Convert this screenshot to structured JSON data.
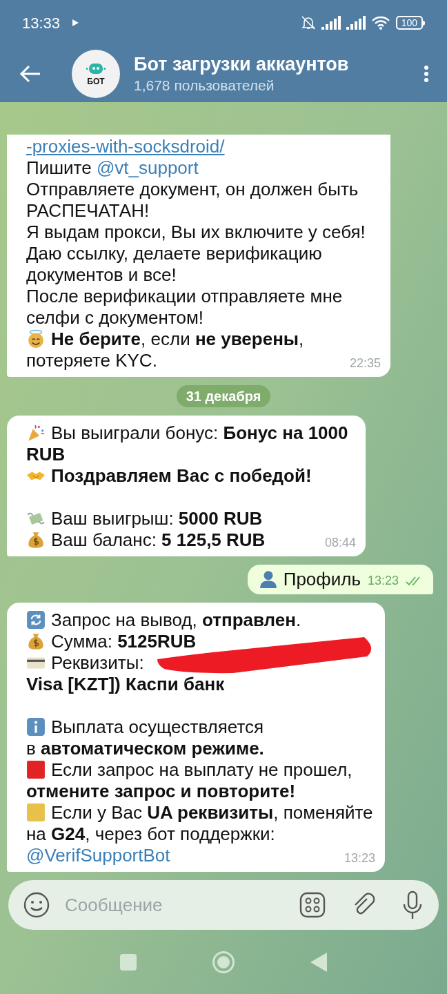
{
  "status_bar": {
    "time": "13:33",
    "battery": "100"
  },
  "header": {
    "title": "Бот загрузки аккаунтов",
    "subtitle": "1,678 пользователей",
    "avatar_text": "БОТ"
  },
  "messages": [
    {
      "kind": "incoming",
      "time": "22:35",
      "lines": [
        {
          "kind": "url",
          "link": "-proxies-with-socksdroid/"
        },
        {
          "kind": "plain",
          "text": "Пишите",
          "link": "@vt_support"
        },
        {
          "kind": "plain",
          "text": "Отправляете документ, он должен быть"
        },
        {
          "kind": "plain",
          "text": "РАСПЕЧАТАН!"
        },
        {
          "kind": "plain",
          "text": "Я выдам прокси, Вы их включите у себя!"
        },
        {
          "kind": "plain",
          "text": "Даю ссылку, делаете верификацию"
        },
        {
          "kind": "plain",
          "text": "документов и все!"
        },
        {
          "kind": "plain",
          "text": "После верификации отправляете мне"
        },
        {
          "kind": "plain",
          "text": "селфи с документом!"
        },
        {
          "kind": "angel",
          "text": "**Не берите**, если **не уверены**,"
        },
        {
          "kind": "plain",
          "text": "потеряете KYC."
        }
      ]
    },
    {
      "kind": "date",
      "text": "31 декабря"
    },
    {
      "kind": "incoming",
      "time": "08:44",
      "lines": [
        {
          "kind": "party",
          "text": "Вы выиграли бонус: **Бонус на 1000**"
        },
        {
          "kind": "plain",
          "text": "**RUB**"
        },
        {
          "kind": "handshake",
          "text": "**Поздравляем Вас с победой!**"
        },
        {
          "kind": "blank"
        },
        {
          "kind": "money_wings",
          "text": "Ваш выигрыш: **5000 RUB**"
        },
        {
          "kind": "moneybag",
          "text": "Ваш баланс: **5 125,5 RUB**"
        }
      ]
    },
    {
      "kind": "outgoing",
      "time": "13:23",
      "read": true,
      "lines": [
        {
          "kind": "person",
          "text": "Профиль"
        }
      ]
    },
    {
      "kind": "incoming",
      "time": "13:23",
      "redacted": true,
      "lines": [
        {
          "kind": "refresh",
          "text": "Запрос на вывод, **отправлен**."
        },
        {
          "kind": "moneybag",
          "text": "Сумма: **5125RUB**"
        },
        {
          "kind": "card",
          "text": "Реквизиты:"
        },
        {
          "kind": "plain",
          "text": "**Visa [KZT]) Каспи банк**"
        },
        {
          "kind": "blank"
        },
        {
          "kind": "info",
          "text": "Выплата осуществляется"
        },
        {
          "kind": "plain",
          "text": "в **автоматическом режиме.**"
        },
        {
          "kind": "stop_square",
          "text": "Если запрос на выплату не прошел,"
        },
        {
          "kind": "plain",
          "text": "**отмените запрос и повторите!**"
        },
        {
          "kind": "warn_square",
          "text": "Если у Вас **UA реквизиты**, поменяйте"
        },
        {
          "kind": "plain",
          "text": "на **G24**, через бот поддержки:"
        },
        {
          "kind": "plain",
          "link": "@VerifSupportBot"
        }
      ]
    }
  ],
  "composer": {
    "placeholder": "Сообщение"
  }
}
